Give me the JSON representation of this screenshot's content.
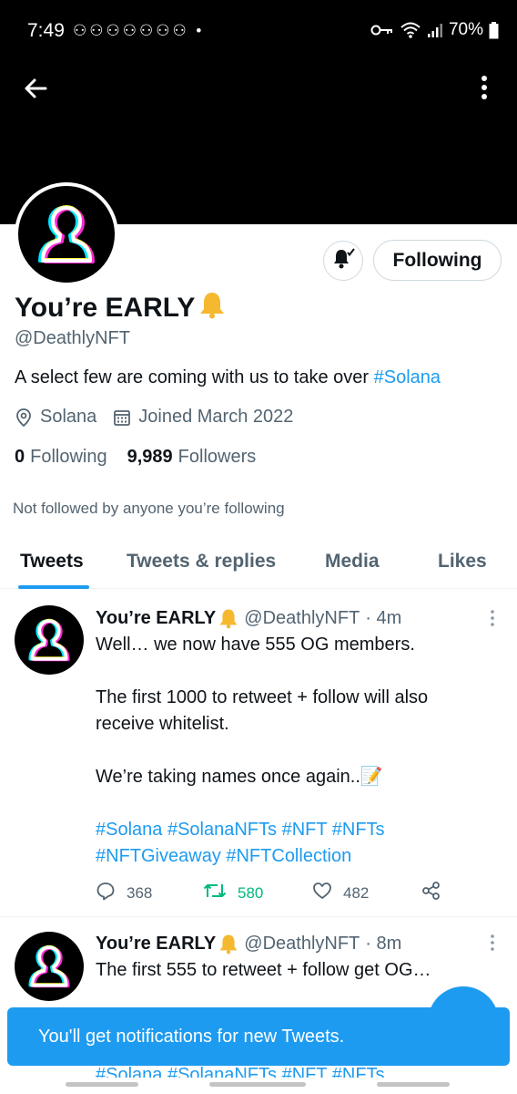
{
  "status_bar": {
    "time": "7:49",
    "notification_icons": "⚇⚇⚇⚇⚇⚇⚇ •",
    "battery": "70%"
  },
  "profile": {
    "display_name": "You’re EARLY",
    "handle": "@DeathlyNFT",
    "bio_text": "A select few are coming with us to take over ",
    "bio_hashtag": "#Solana",
    "location": "Solana",
    "joined": "Joined March 2022",
    "following_count": "0",
    "following_label": "Following",
    "followers_count": "9,989",
    "followers_label": "Followers",
    "not_followed_text": "Not followed by anyone you’re following"
  },
  "actions": {
    "following_button_label": "Following"
  },
  "tabs": [
    {
      "label": "Tweets",
      "active": true
    },
    {
      "label": "Tweets & replies",
      "active": false
    },
    {
      "label": "Media",
      "active": false
    },
    {
      "label": "Likes",
      "active": false
    }
  ],
  "tweets": [
    {
      "name": "You’re EARLY",
      "handle": "@DeathlyNFT",
      "time": "· 4m",
      "lines": [
        "Well… we now have 555 OG members.",
        "",
        "The first 1000 to retweet + follow will also",
        "receive whitelist.",
        "",
        "We’re taking names once again..📝"
      ],
      "hashtag_lines": [
        "#Solana #SolanaNFTs #NFT #NFTs",
        "#NFTGiveaway #NFTCollection"
      ],
      "replies": "368",
      "retweets": "580",
      "likes": "482"
    },
    {
      "name": "You’re EARLY",
      "handle": "@DeathlyNFT",
      "time": "· 8m",
      "lines": [
        "The first 555 to retweet + follow get OG…"
      ],
      "hidden_hashtag_line": "#Solana #SolanaNFTs #NFT #NFTs"
    }
  ],
  "toast": {
    "message": "You'll get notifications for new Tweets."
  },
  "colors": {
    "accent": "#1d9bf0",
    "retweet_green": "#00ba7c",
    "muted_text": "#536471",
    "primary_text": "#0f1419",
    "banner": "#000000"
  }
}
